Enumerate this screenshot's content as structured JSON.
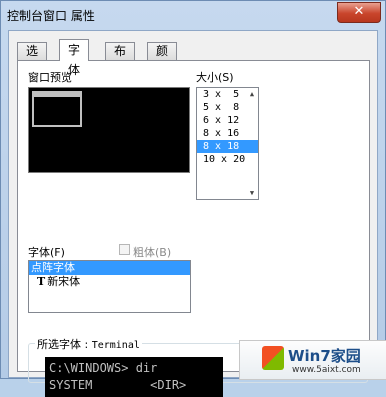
{
  "window": {
    "title": "控制台窗口 属性",
    "close_glyph": "✕"
  },
  "tabs": [
    {
      "label": "选项",
      "active": false
    },
    {
      "label": "字体",
      "active": true
    },
    {
      "label": "布局",
      "active": false
    },
    {
      "label": "颜色",
      "active": false
    }
  ],
  "preview": {
    "label": "窗口预览"
  },
  "size": {
    "label": "大小(S)",
    "items": [
      "3 x  5",
      "5 x  8",
      "6 x 12",
      "8 x 16",
      "8 x 18",
      "10 x 20"
    ],
    "selected": "8 x 18"
  },
  "font": {
    "label": "字体(F)",
    "bold_label": "粗体(B)",
    "items": [
      {
        "name": "点阵字体",
        "selected": true,
        "icon": ""
      },
      {
        "name": "新宋体",
        "selected": false,
        "icon": "truetype-icon"
      }
    ],
    "truetype_glyph": "T"
  },
  "selected_font": {
    "label": "所选字体 :",
    "font_name": "Terminal",
    "sample_line1": "C:\\WINDOWS> dir",
    "sample_line2": "SYSTEM        <DIR>"
  },
  "watermark": {
    "brand": "Win7家园",
    "url": "www.5aixt.com"
  },
  "colors": {
    "selection": "#3399ff",
    "console_bg": "#000000",
    "console_fg": "#c0c0c0"
  }
}
